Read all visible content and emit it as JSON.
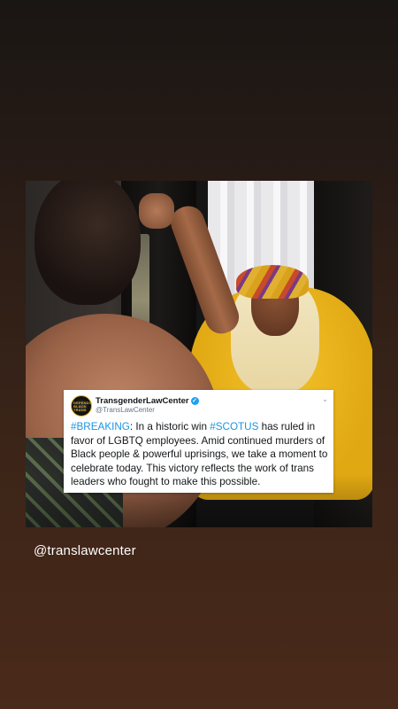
{
  "story": {
    "mention": "@translawcenter"
  },
  "tweet": {
    "account_name": "TransgenderLawCenter",
    "account_handle": "@TransLawCenter",
    "avatar_text": "DEFENDING BLACK TRANS",
    "segments": [
      {
        "text": "#BREAKING",
        "hashtag": true
      },
      {
        "text": ": In a historic win ",
        "hashtag": false
      },
      {
        "text": "#SCOTUS",
        "hashtag": true
      },
      {
        "text": " has ruled in favor of LGBTQ employees. Amid continued murders of Black people & powerful uprisings, we take a moment to celebrate today. This victory reflects the work of trans leaders who fought to make this possible.",
        "hashtag": false
      }
    ]
  },
  "colors": {
    "hashtag": "#1b95e0",
    "verified": "#1da1f2",
    "shirt": "#f4c22a"
  }
}
